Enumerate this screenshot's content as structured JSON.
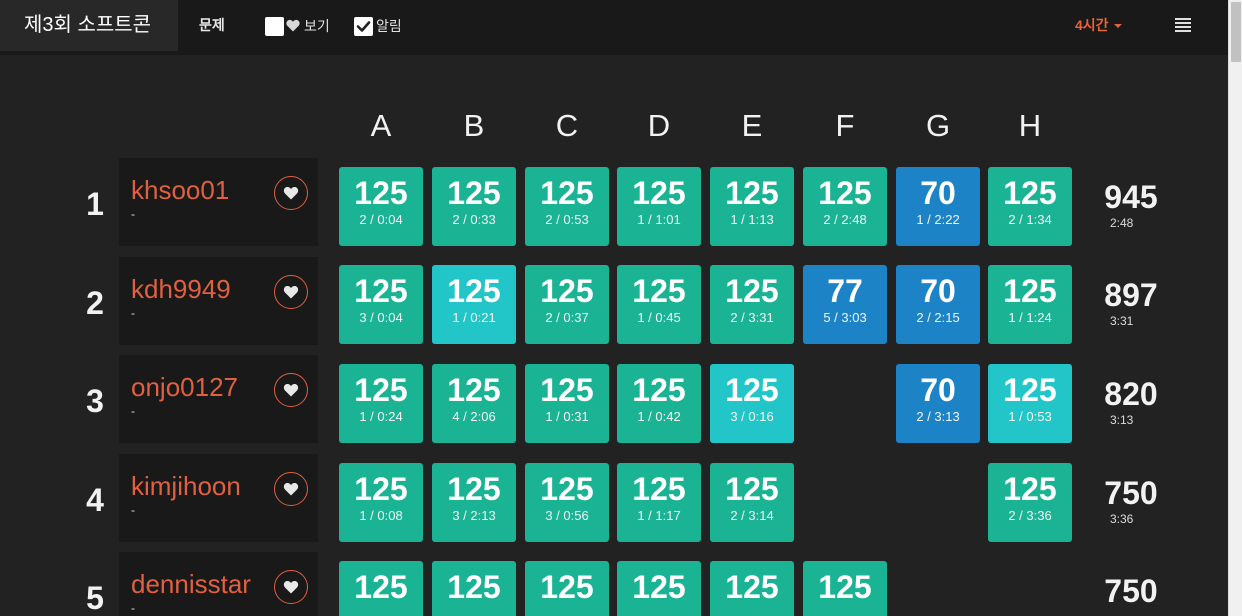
{
  "nav": {
    "brand": "제3회 소프트콘",
    "problems_label": "문제",
    "watch_label": "보기",
    "alarm_label": "알림",
    "watch_checked": false,
    "alarm_checked": true,
    "time_label": "4시간",
    "menu_icon": "hamburger-menu-icon"
  },
  "columns": [
    "A",
    "B",
    "C",
    "D",
    "E",
    "F",
    "G",
    "H"
  ],
  "colors": {
    "green": "#1ab394",
    "cyan": "#23c6c8",
    "blue": "#1c84c6",
    "accent": "#e0603f",
    "time_accent": "#e8623a"
  },
  "rows": [
    {
      "rank": "1",
      "name": "khsoo01",
      "sub": "-",
      "cells": [
        {
          "pts": "125",
          "detail": "2 / 0:04",
          "color": "green"
        },
        {
          "pts": "125",
          "detail": "2 / 0:33",
          "color": "green"
        },
        {
          "pts": "125",
          "detail": "2 / 0:53",
          "color": "green"
        },
        {
          "pts": "125",
          "detail": "1 / 1:01",
          "color": "green"
        },
        {
          "pts": "125",
          "detail": "1 / 1:13",
          "color": "green"
        },
        {
          "pts": "125",
          "detail": "2 / 2:48",
          "color": "green"
        },
        {
          "pts": "70",
          "detail": "1 / 2:22",
          "color": "blue"
        },
        {
          "pts": "125",
          "detail": "2 / 1:34",
          "color": "green"
        }
      ],
      "total": "945",
      "total_time": "2:48"
    },
    {
      "rank": "2",
      "name": "kdh9949",
      "sub": "-",
      "cells": [
        {
          "pts": "125",
          "detail": "3 / 0:04",
          "color": "green"
        },
        {
          "pts": "125",
          "detail": "1 / 0:21",
          "color": "cyan"
        },
        {
          "pts": "125",
          "detail": "2 / 0:37",
          "color": "green"
        },
        {
          "pts": "125",
          "detail": "1 / 0:45",
          "color": "green"
        },
        {
          "pts": "125",
          "detail": "2 / 3:31",
          "color": "green"
        },
        {
          "pts": "77",
          "detail": "5 / 3:03",
          "color": "blue"
        },
        {
          "pts": "70",
          "detail": "2 / 2:15",
          "color": "blue"
        },
        {
          "pts": "125",
          "detail": "1 / 1:24",
          "color": "green"
        }
      ],
      "total": "897",
      "total_time": "3:31"
    },
    {
      "rank": "3",
      "name": "onjo0127",
      "sub": "-",
      "cells": [
        {
          "pts": "125",
          "detail": "1 / 0:24",
          "color": "green"
        },
        {
          "pts": "125",
          "detail": "4 / 2:06",
          "color": "green"
        },
        {
          "pts": "125",
          "detail": "1 / 0:31",
          "color": "green"
        },
        {
          "pts": "125",
          "detail": "1 / 0:42",
          "color": "green"
        },
        {
          "pts": "125",
          "detail": "3 / 0:16",
          "color": "cyan"
        },
        null,
        {
          "pts": "70",
          "detail": "2 / 3:13",
          "color": "blue"
        },
        {
          "pts": "125",
          "detail": "1 / 0:53",
          "color": "cyan"
        }
      ],
      "total": "820",
      "total_time": "3:13"
    },
    {
      "rank": "4",
      "name": "kimjihoon",
      "sub": "-",
      "cells": [
        {
          "pts": "125",
          "detail": "1 / 0:08",
          "color": "green"
        },
        {
          "pts": "125",
          "detail": "3 / 2:13",
          "color": "green"
        },
        {
          "pts": "125",
          "detail": "3 / 0:56",
          "color": "green"
        },
        {
          "pts": "125",
          "detail": "1 / 1:17",
          "color": "green"
        },
        {
          "pts": "125",
          "detail": "2 / 3:14",
          "color": "green"
        },
        null,
        null,
        {
          "pts": "125",
          "detail": "2 / 3:36",
          "color": "green"
        }
      ],
      "total": "750",
      "total_time": "3:36"
    },
    {
      "rank": "5",
      "name": "dennisstar",
      "sub": "-",
      "cells": [
        {
          "pts": "125",
          "detail": "",
          "color": "green"
        },
        {
          "pts": "125",
          "detail": "",
          "color": "green"
        },
        {
          "pts": "125",
          "detail": "",
          "color": "green"
        },
        {
          "pts": "125",
          "detail": "",
          "color": "green"
        },
        {
          "pts": "125",
          "detail": "",
          "color": "green"
        },
        {
          "pts": "125",
          "detail": "",
          "color": "green"
        },
        null,
        null
      ],
      "total": "750",
      "total_time": ""
    }
  ]
}
